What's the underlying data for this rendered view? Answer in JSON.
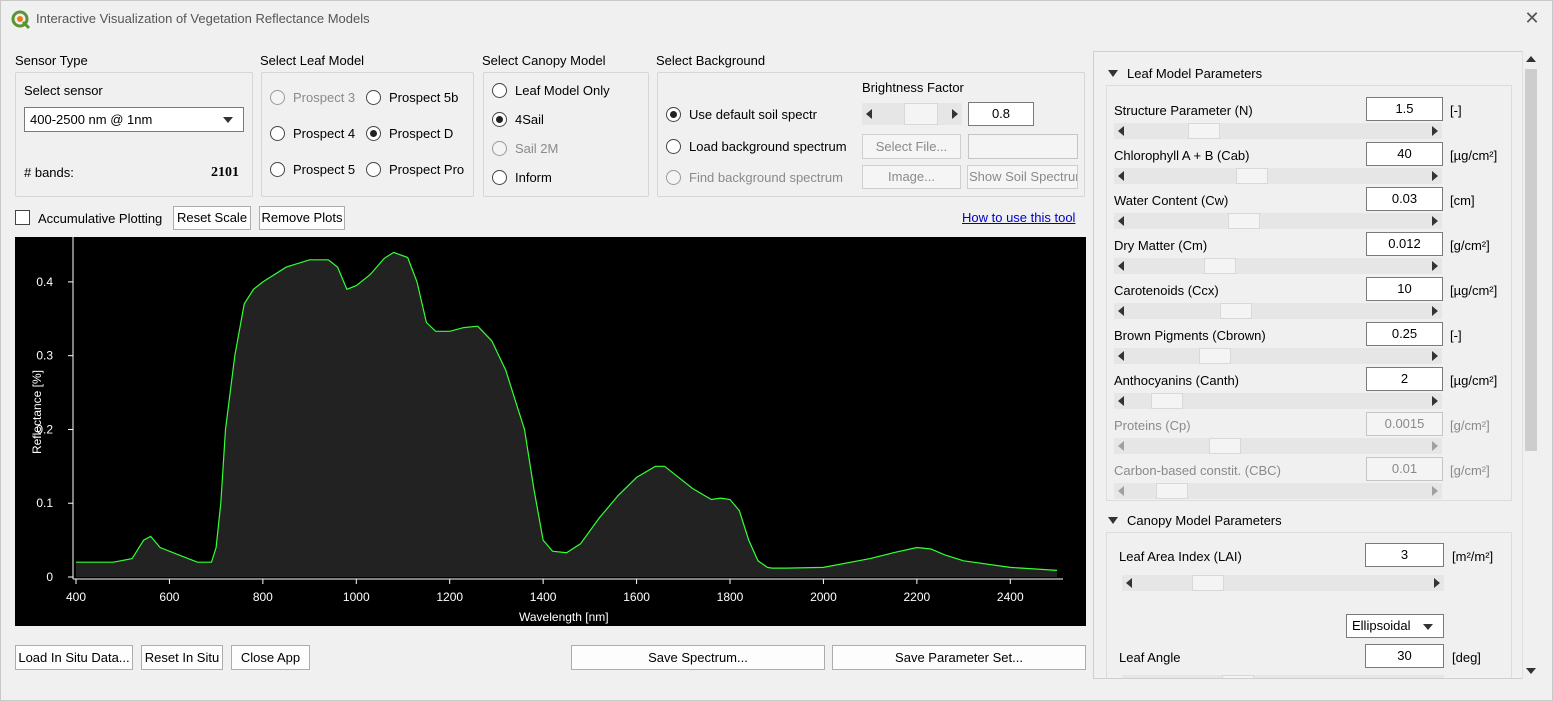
{
  "window": {
    "title": "Interactive Visualization of Vegetation Reflectance Models"
  },
  "sensor": {
    "heading": "Sensor Type",
    "select_label": "Select sensor",
    "selected": "400-2500 nm @ 1nm",
    "bands_label": "# bands:",
    "bands_value": "2101"
  },
  "leaf_model": {
    "heading": "Select Leaf Model",
    "options": [
      {
        "label": "Prospect 3",
        "checked": false,
        "enabled": false
      },
      {
        "label": "Prospect 5b",
        "checked": false,
        "enabled": true
      },
      {
        "label": "Prospect 4",
        "checked": false,
        "enabled": true
      },
      {
        "label": "Prospect D",
        "checked": true,
        "enabled": true
      },
      {
        "label": "Prospect 5",
        "checked": false,
        "enabled": true
      },
      {
        "label": "Prospect Pro",
        "checked": false,
        "enabled": true
      }
    ]
  },
  "canopy_model": {
    "heading": "Select Canopy Model",
    "options": [
      {
        "label": "Leaf Model Only",
        "checked": false,
        "enabled": true
      },
      {
        "label": "4Sail",
        "checked": true,
        "enabled": true
      },
      {
        "label": "Sail 2M",
        "checked": false,
        "enabled": false
      },
      {
        "label": "Inform",
        "checked": false,
        "enabled": true
      }
    ]
  },
  "background": {
    "heading": "Select Background",
    "brightness_label": "Brightness Factor",
    "brightness_value": "0.8",
    "options": [
      {
        "label": "Use default soil spectr",
        "checked": true,
        "enabled": true
      },
      {
        "label": "Load background spectrum",
        "checked": false,
        "enabled": true
      },
      {
        "label": "Find background spectrum",
        "checked": false,
        "enabled": false
      }
    ],
    "select_file_label": "Select File...",
    "image_label": "Image...",
    "show_soil_label": "Show Soil Spectrum",
    "file_path": ""
  },
  "toolbar": {
    "accumulative_label": "Accumulative Plotting",
    "reset_scale_label": "Reset Scale",
    "remove_plots_label": "Remove Plots",
    "howto_label": "How to use this tool"
  },
  "chart_data": {
    "type": "area",
    "xlabel": "Wavelength [nm]",
    "ylabel": "Reflectance [%]",
    "xlim": [
      400,
      2500
    ],
    "ylim": [
      0,
      0.45
    ],
    "xticks": [
      "400",
      "600",
      "800",
      "1000",
      "1200",
      "1400",
      "1600",
      "1800",
      "2000",
      "2200",
      "2400"
    ],
    "yticks": [
      "0",
      "0.1",
      "0.2",
      "0.3",
      "0.4"
    ],
    "line_color": "#33ff33",
    "fill_color": "#222222",
    "background": "#000000",
    "x": [
      400,
      480,
      520,
      545,
      560,
      580,
      620,
      660,
      690,
      700,
      710,
      720,
      740,
      760,
      780,
      800,
      850,
      900,
      940,
      960,
      980,
      1000,
      1030,
      1060,
      1080,
      1110,
      1130,
      1150,
      1170,
      1200,
      1230,
      1260,
      1290,
      1320,
      1340,
      1360,
      1380,
      1400,
      1420,
      1450,
      1480,
      1520,
      1560,
      1600,
      1640,
      1660,
      1680,
      1720,
      1760,
      1780,
      1800,
      1820,
      1840,
      1860,
      1880,
      1890,
      1920,
      2000,
      2100,
      2150,
      2200,
      2230,
      2260,
      2300,
      2400,
      2500
    ],
    "y": [
      0.02,
      0.02,
      0.025,
      0.05,
      0.055,
      0.04,
      0.03,
      0.02,
      0.02,
      0.04,
      0.1,
      0.2,
      0.3,
      0.37,
      0.39,
      0.4,
      0.42,
      0.43,
      0.43,
      0.42,
      0.39,
      0.395,
      0.41,
      0.432,
      0.44,
      0.433,
      0.4,
      0.345,
      0.333,
      0.333,
      0.338,
      0.34,
      0.32,
      0.28,
      0.24,
      0.2,
      0.12,
      0.05,
      0.035,
      0.033,
      0.045,
      0.08,
      0.11,
      0.135,
      0.15,
      0.15,
      0.14,
      0.12,
      0.105,
      0.107,
      0.105,
      0.09,
      0.05,
      0.022,
      0.013,
      0.012,
      0.012,
      0.013,
      0.025,
      0.033,
      0.04,
      0.038,
      0.03,
      0.022,
      0.013,
      0.009
    ]
  },
  "bottom": {
    "load_insitu_label": "Load In Situ Data...",
    "reset_insitu_label": "Reset In Situ",
    "close_app_label": "Close App",
    "save_spectrum_label": "Save Spectrum...",
    "save_params_label": "Save Parameter Set..."
  },
  "leaf_params": {
    "heading": "Leaf Model Parameters",
    "items": [
      {
        "label": "Structure Parameter (N)",
        "value": "1.5",
        "unit": "[-]",
        "enabled": true,
        "thumb": 0.22
      },
      {
        "label": "Chlorophyll A + B (Cab)",
        "value": "40",
        "unit": "[µg/cm²]",
        "enabled": true,
        "thumb": 0.4
      },
      {
        "label": "Water Content (Cw)",
        "value": "0.03",
        "unit": "[cm]",
        "enabled": true,
        "thumb": 0.37
      },
      {
        "label": "Dry Matter (Cm)",
        "value": "0.012",
        "unit": "[g/cm²]",
        "enabled": true,
        "thumb": 0.28
      },
      {
        "label": "Carotenoids (Ccx)",
        "value": "10",
        "unit": "[µg/cm²]",
        "enabled": true,
        "thumb": 0.34
      },
      {
        "label": "Brown Pigments (Cbrown)",
        "value": "0.25",
        "unit": "[-]",
        "enabled": true,
        "thumb": 0.26
      },
      {
        "label": "Anthocyanins (Canth)",
        "value": "2",
        "unit": "[µg/cm²]",
        "enabled": true,
        "thumb": 0.08
      },
      {
        "label": "Proteins (Cp)",
        "value": "0.0015",
        "unit": "[g/cm²]",
        "enabled": false,
        "thumb": 0.3
      },
      {
        "label": "Carbon-based constit. (CBC)",
        "value": "0.01",
        "unit": "[g/cm²]",
        "enabled": false,
        "thumb": 0.1
      }
    ]
  },
  "canopy_params": {
    "heading": "Canopy Model Parameters",
    "lai_label": "Leaf Area Index (LAI)",
    "lai_value": "3",
    "lai_unit": "[m²/m²]",
    "lai_thumb": 0.21,
    "lidf_selected": "Ellipsoidal",
    "leaf_angle_label": "Leaf Angle",
    "leaf_angle_value": "30",
    "leaf_angle_unit": "[deg]"
  }
}
